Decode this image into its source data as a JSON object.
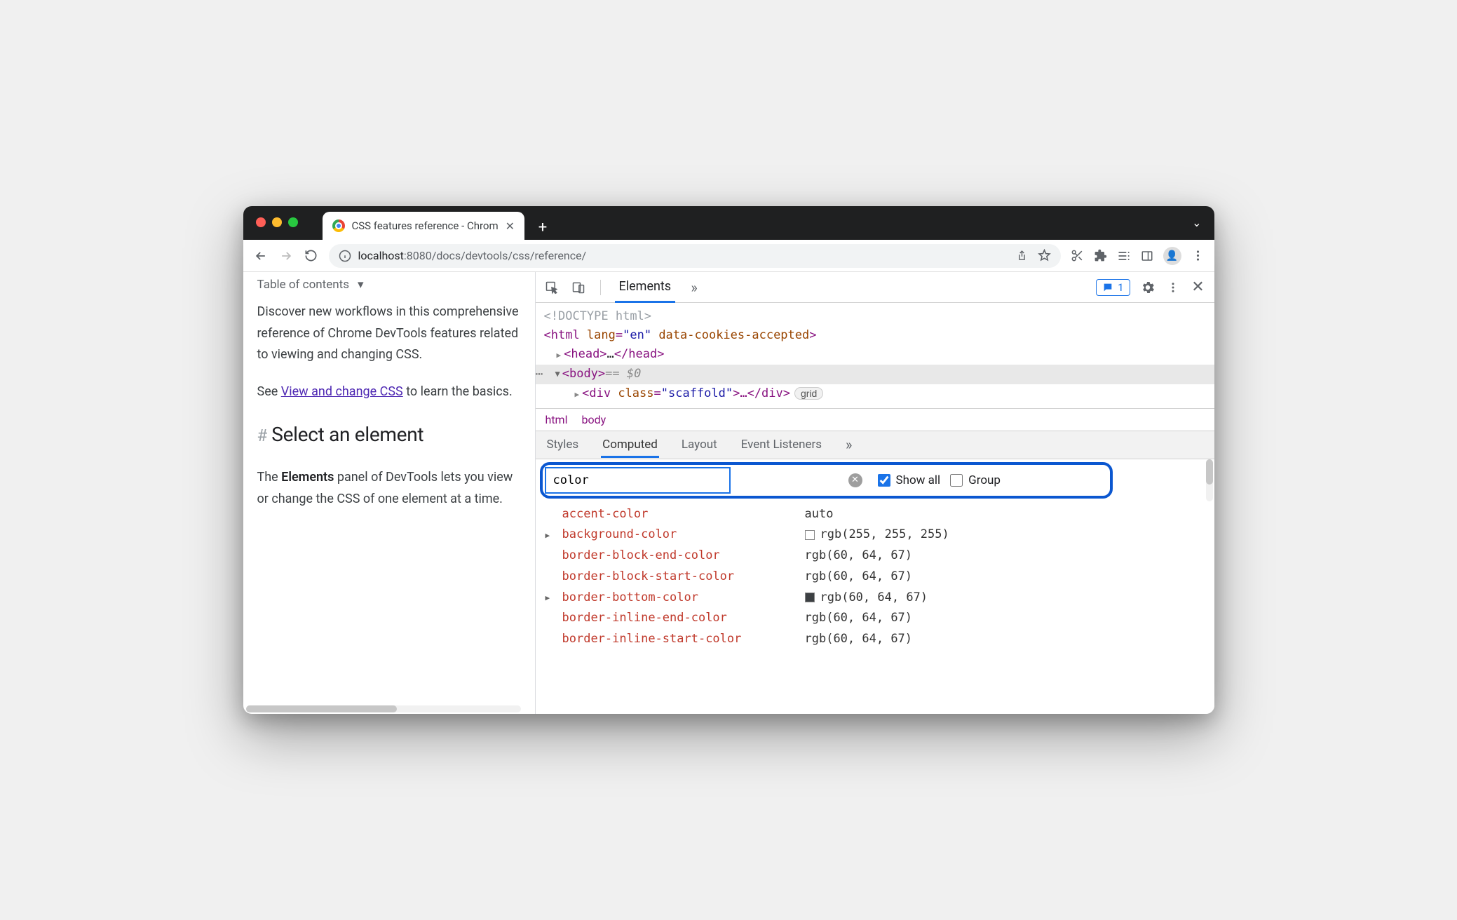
{
  "tab": {
    "title": "CSS features reference - Chrom"
  },
  "url": {
    "host": "localhost",
    "port_path": ":8080/docs/devtools/css/reference/"
  },
  "page": {
    "toc": "Table of contents",
    "p1": "Discover new workflows in this comprehensive reference of Chrome DevTools features related to viewing and changing CSS.",
    "p2_a": "See ",
    "p2_link": "View and change CSS",
    "p2_b": " to learn the basics.",
    "h2": "Select an element",
    "p3_a": "The ",
    "p3_bold": "Elements",
    "p3_b": " panel of DevTools lets you view or change the CSS of one element at a time."
  },
  "devtools": {
    "tabs": {
      "elements": "Elements"
    },
    "messages_count": "1",
    "dom": {
      "doctype": "<!DOCTYPE html>",
      "html_open1": "<html ",
      "html_lang_attr": "lang",
      "html_lang_val": "\"en\"",
      "html_cookies_attr": " data-cookies-accepted",
      "html_open2": ">",
      "head": "<head>…</head>",
      "body_open": "<body>",
      "body_eq": "  ==  ",
      "body_dollar": "$0",
      "div_open": "<div ",
      "div_class_attr": "class",
      "div_class_val": "\"scaffold\"",
      "div_rest": ">…</div>",
      "grid_badge": "grid"
    },
    "crumbs": {
      "html": "html",
      "body": "body"
    },
    "subtabs": {
      "styles": "Styles",
      "computed": "Computed",
      "layout": "Layout",
      "listeners": "Event Listeners"
    },
    "filter": {
      "value": "color",
      "showall": "Show all",
      "group": "Group"
    },
    "computed": [
      {
        "prop": "accent-color",
        "val": "auto",
        "swatch": null,
        "expand": false
      },
      {
        "prop": "background-color",
        "val": "rgb(255, 255, 255)",
        "swatch": "white",
        "expand": true
      },
      {
        "prop": "border-block-end-color",
        "val": "rgb(60, 64, 67)",
        "swatch": null,
        "expand": false
      },
      {
        "prop": "border-block-start-color",
        "val": "rgb(60, 64, 67)",
        "swatch": null,
        "expand": false
      },
      {
        "prop": "border-bottom-color",
        "val": "rgb(60, 64, 67)",
        "swatch": "gray",
        "expand": true
      },
      {
        "prop": "border-inline-end-color",
        "val": "rgb(60, 64, 67)",
        "swatch": null,
        "expand": false
      },
      {
        "prop": "border-inline-start-color",
        "val": "rgb(60, 64, 67)",
        "swatch": null,
        "expand": false
      }
    ]
  }
}
